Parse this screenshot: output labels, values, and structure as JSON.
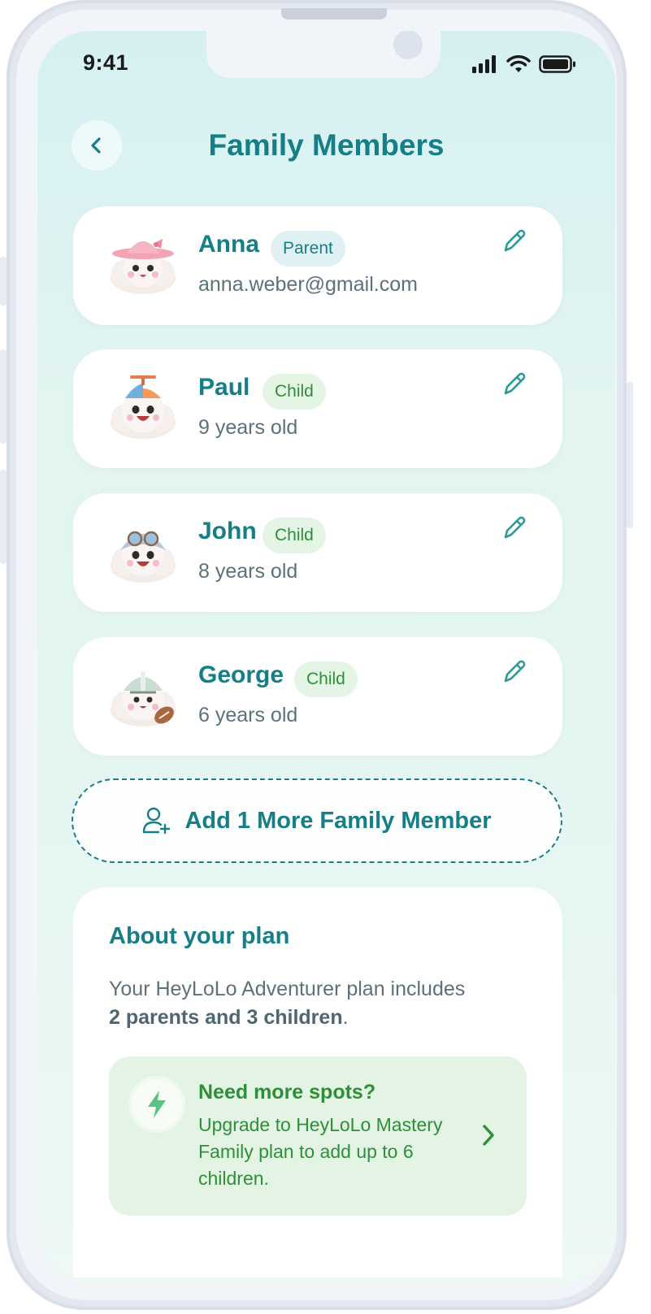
{
  "status_bar": {
    "time": "9:41"
  },
  "header": {
    "title": "Family Members"
  },
  "members": [
    {
      "name": "Anna",
      "role": "Parent",
      "detail": "anna.weber@gmail.com",
      "avatar": "cloud-pink-hat-avatar"
    },
    {
      "name": "Paul",
      "role": "Child",
      "detail": "9 years old",
      "avatar": "cloud-propeller-cap-avatar"
    },
    {
      "name": "John",
      "role": "Child",
      "detail": "8 years old",
      "avatar": "cloud-aviator-goggles-avatar"
    },
    {
      "name": "George",
      "role": "Child",
      "detail": "6 years old",
      "avatar": "cloud-football-helmet-avatar"
    }
  ],
  "add_member": {
    "label": "Add 1 More Family Member",
    "icon": "add-user-icon"
  },
  "plan": {
    "title": "About your plan",
    "text_prefix": "Your HeyLoLo Adventurer plan includes",
    "text_bold": "2 parents and 3 children",
    "text_suffix": ".",
    "upgrade": {
      "title": "Need more spots?",
      "text": "Upgrade to HeyLoLo Mastery Family plan to add up to 6 children.",
      "icon": "lightning-icon"
    }
  },
  "colors": {
    "primary": "#167e86",
    "green": "#2e8f39",
    "muted_text": "#5e7078",
    "parent_badge_bg": "#e0f1f3",
    "child_badge_bg": "#e4f5e5",
    "upgrade_bg": "#e3f4e5"
  }
}
